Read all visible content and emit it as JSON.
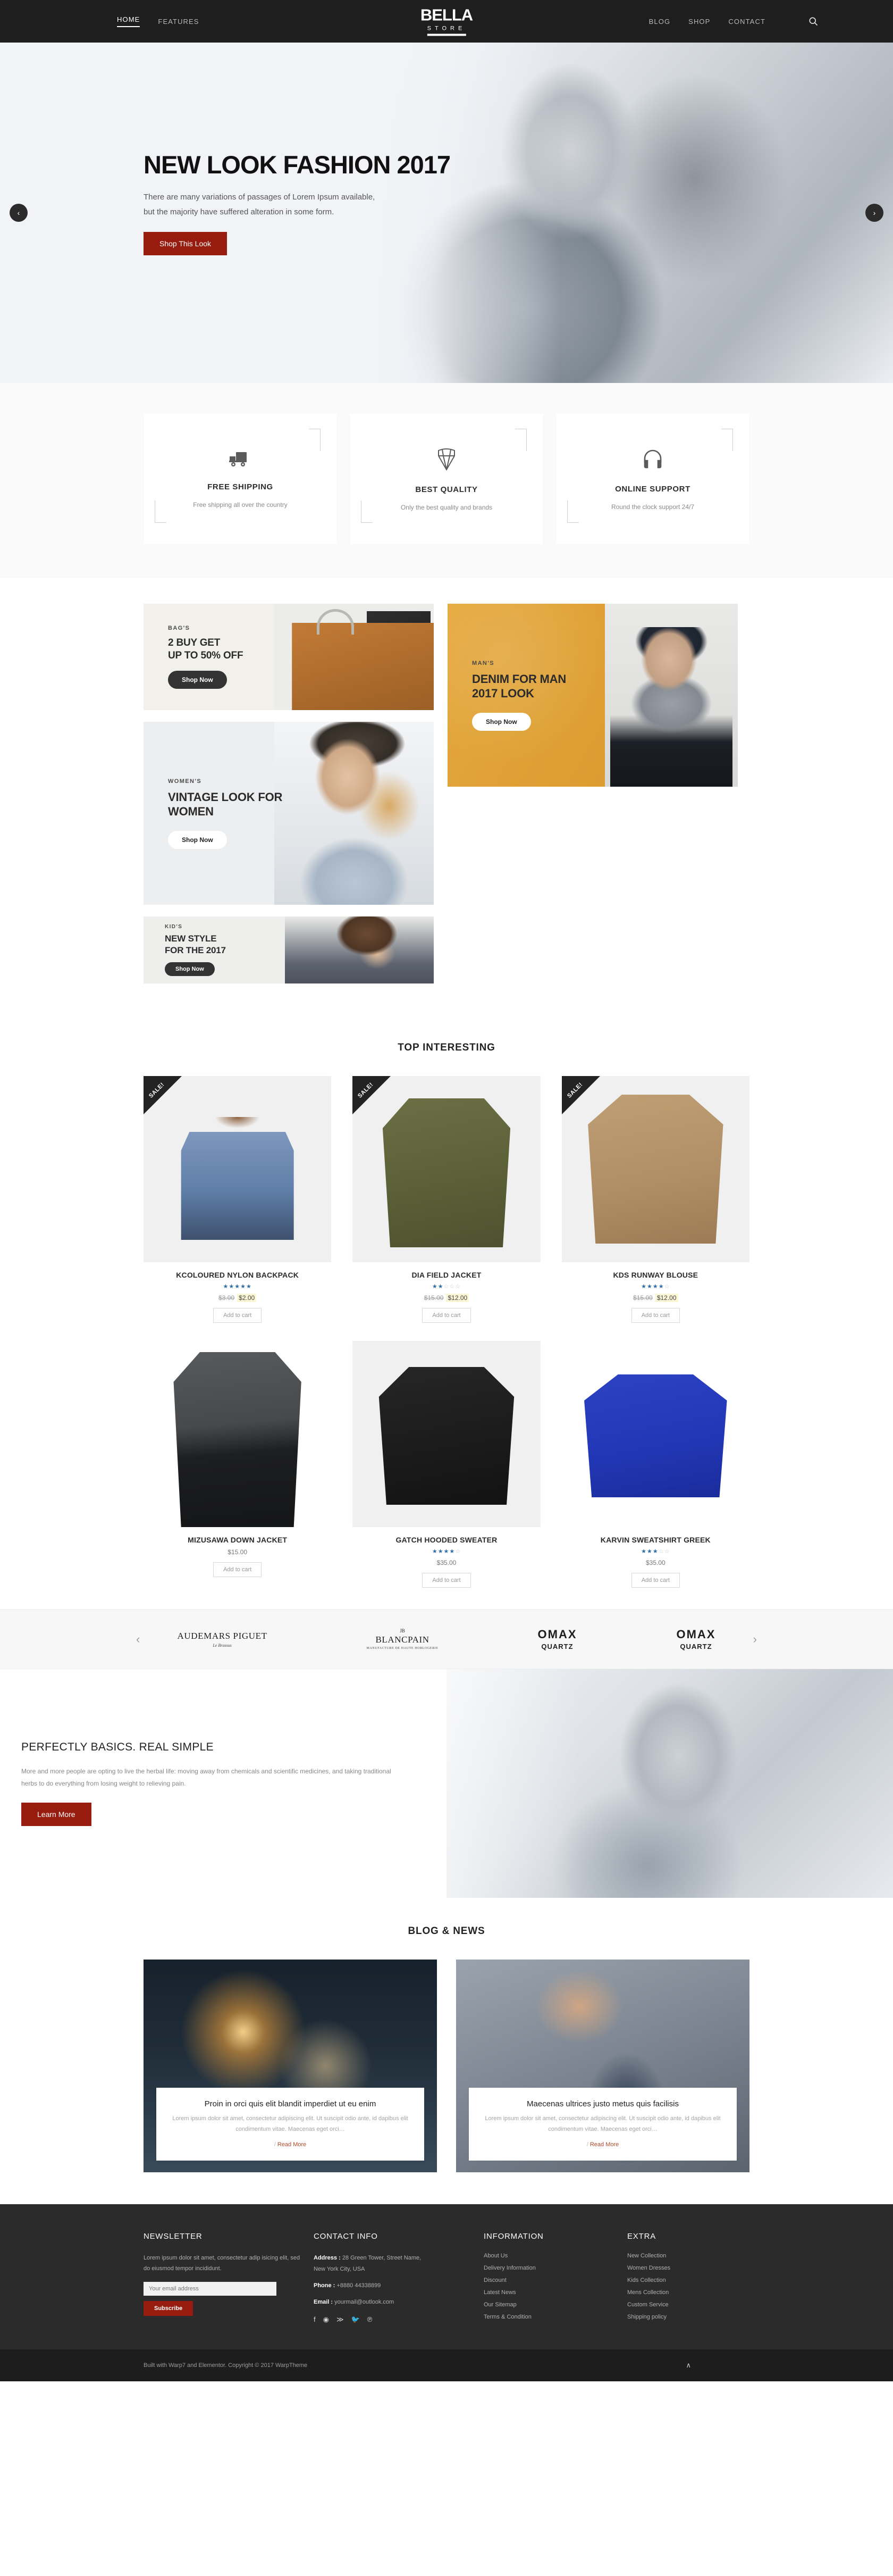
{
  "header": {
    "nav_left": [
      {
        "label": "HOME",
        "active": true
      },
      {
        "label": "FEATURES",
        "active": false
      }
    ],
    "nav_right": [
      {
        "label": "BLOG"
      },
      {
        "label": "SHOP"
      },
      {
        "label": "CONTACT"
      }
    ],
    "brand_main": "BELLA",
    "brand_sub": "STORE",
    "search_icon": "search-icon"
  },
  "hero": {
    "title": "NEW LOOK FASHION 2017",
    "line1": "There are many variations of passages of Lorem Ipsum available,",
    "line2": "but the majority have suffered alteration in some form.",
    "cta": "Shop This Look",
    "prev": "‹",
    "next": "›"
  },
  "services": [
    {
      "icon": "truck-icon",
      "title": "FREE SHIPPING",
      "desc": "Free shipping all over the country"
    },
    {
      "icon": "diamond-icon",
      "title": "BEST QUALITY",
      "desc": "Only the best quality and brands"
    },
    {
      "icon": "headphones-icon",
      "title": "ONLINE SUPPORT",
      "desc": "Round the clock support 24/7"
    }
  ],
  "promos": [
    {
      "kicker": "BAG'S",
      "title": "2 BUY GET\nUP TO 50% OFF",
      "button": "Shop Now"
    },
    {
      "kicker": "MAN'S",
      "title": "DENIM FOR MAN\n2017 LOOK",
      "button": "Shop Now"
    },
    {
      "kicker": "WOMEN'S",
      "title": "VINTAGE LOOK FOR\nWOMEN",
      "button": "Shop Now"
    },
    {
      "kicker": "KID'S",
      "title": "NEW STYLE\nFOR THE 2017",
      "button": "Shop Now"
    }
  ],
  "products_section": {
    "title": "TOP INTERESTING",
    "sale_badge": "SALE!",
    "add_to_cart": "Add to cart"
  },
  "products": [
    {
      "name": "KCOLOURED NYLON BACKPACK",
      "rating": 5,
      "old_price": "$3.00",
      "price": "$2.00",
      "on_sale": true
    },
    {
      "name": "DIA FIELD JACKET",
      "rating": 2,
      "old_price": "$15.00",
      "price": "$12.00",
      "on_sale": true
    },
    {
      "name": "KDS RUNWAY BLOUSE",
      "rating": 4,
      "old_price": "$15.00",
      "price": "$12.00",
      "on_sale": true
    },
    {
      "name": "MIZUSAWA DOWN JACKET",
      "rating": 0,
      "old_price": "",
      "price": "$15.00",
      "on_sale": false
    },
    {
      "name": "GATCH HOODED SWEATER",
      "rating": 4,
      "old_price": "",
      "price": "$35.00",
      "on_sale": false
    },
    {
      "name": "KARVIN SWEATSHIRT GREEK",
      "rating": 3,
      "old_price": "",
      "price": "$35.00",
      "on_sale": false
    }
  ],
  "brands": {
    "prev": "‹",
    "next": "›",
    "items": [
      {
        "name": "AUDEMARS PIGUET",
        "sub": "Le Brassus",
        "style": "serif"
      },
      {
        "name": "BLANCPAIN",
        "sub": "MANUFACTURE DE HAUTE HORLOGERIE",
        "top": "JB",
        "style": "serif-caps"
      },
      {
        "name": "OMAX",
        "sub": "QUARTZ",
        "style": "omax"
      },
      {
        "name": "OMAX",
        "sub": "QUARTZ",
        "style": "omax"
      }
    ]
  },
  "about": {
    "title": "PERFECTLY BASICS. REAL SIMPLE",
    "text": "More and more people are opting to live the herbal life: moving away from chemicals and scientific medicines, and taking traditional herbs to do everything from losing weight to relieving pain.",
    "cta": "Learn More"
  },
  "blog_section": {
    "title": "BLOG & NEWS",
    "read_more": "Read More",
    "separator": "/"
  },
  "blog_posts": [
    {
      "title": "Proin in orci quis elit blandit imperdiet ut eu enim",
      "excerpt": "Lorem ipsum dolor sit amet, consectetur adipiscing elit. Ut suscipit odio ante, id dapibus elit condimentum vitae. Maecenas eget orci…"
    },
    {
      "title": "Maecenas ultrices justo metus quis facilisis",
      "excerpt": "Lorem ipsum dolor sit amet, consectetur adipiscing elit. Ut suscipit odio ante, id dapibus elit condimentum vitae. Maecenas eget orci…"
    }
  ],
  "footer": {
    "newsletter": {
      "heading": "NEWSLETTER",
      "text": "Lorem ipsum dolor sit amet, consectetur adip isicing elit, sed do eiusmod tempor incididunt.",
      "placeholder": "Your email address",
      "button": "Subscribe"
    },
    "contact": {
      "heading": "CONTACT INFO",
      "address_label": "Address :",
      "address_value": "28 Green Tower, Street Name,",
      "address_value2": "New York City, USA",
      "phone_label": "Phone :",
      "phone_value": "+8880 44338899",
      "email_label": "Email :",
      "email_value": "yourmail@outlook.com",
      "socials": [
        "facebook-icon",
        "instagram-icon",
        "rss-icon",
        "twitter-icon",
        "pinterest-icon"
      ]
    },
    "information": {
      "heading": "INFORMATION",
      "links": [
        "About Us",
        "Delivery Information",
        "Discount",
        "Latest News",
        "Our Sitemap",
        "Terms & Condition"
      ]
    },
    "extra": {
      "heading": "EXTRA",
      "links": [
        "New Collection",
        "Women Dresses",
        "Kids Collection",
        "Mens Collection",
        "Custom Service",
        "Shipping policy"
      ]
    },
    "copyright": "Built with Warp7 and Elementor. Copyright © 2017 WarpTheme",
    "to_top": "∧"
  },
  "colors": {
    "accent_red": "#981b10",
    "dark": "#1e1e1e",
    "footer_bg": "#2b2b2b",
    "promo_yellow": "#e2a53b",
    "star_blue": "#2e6ea8"
  }
}
